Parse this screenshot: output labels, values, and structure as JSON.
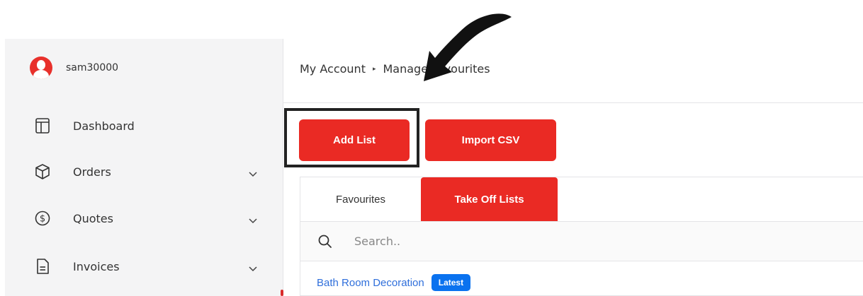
{
  "user": {
    "name": "sam30000"
  },
  "sidebar": {
    "items": [
      {
        "label": "Dashboard",
        "icon": "layout-icon",
        "has_chevron": false
      },
      {
        "label": "Orders",
        "icon": "box-icon",
        "has_chevron": true
      },
      {
        "label": "Quotes",
        "icon": "dollar-circle-icon",
        "has_chevron": true
      },
      {
        "label": "Invoices",
        "icon": "document-icon",
        "has_chevron": true
      }
    ]
  },
  "breadcrumb": {
    "root": "My Account",
    "separator": "▸",
    "current": "Manage Favourites"
  },
  "toolbar": {
    "add_list_label": "Add List",
    "import_csv_label": "Import CSV"
  },
  "tabs": [
    {
      "label": "Favourites",
      "active": false
    },
    {
      "label": "Take Off Lists",
      "active": true
    }
  ],
  "search": {
    "placeholder": "Search.."
  },
  "lists": [
    {
      "name": "Bath Room Decoration",
      "badge": "Latest"
    }
  ],
  "colors": {
    "brand_red": "#ea2a24",
    "link_blue": "#2f6fdb",
    "badge_blue": "#0a72ef"
  }
}
